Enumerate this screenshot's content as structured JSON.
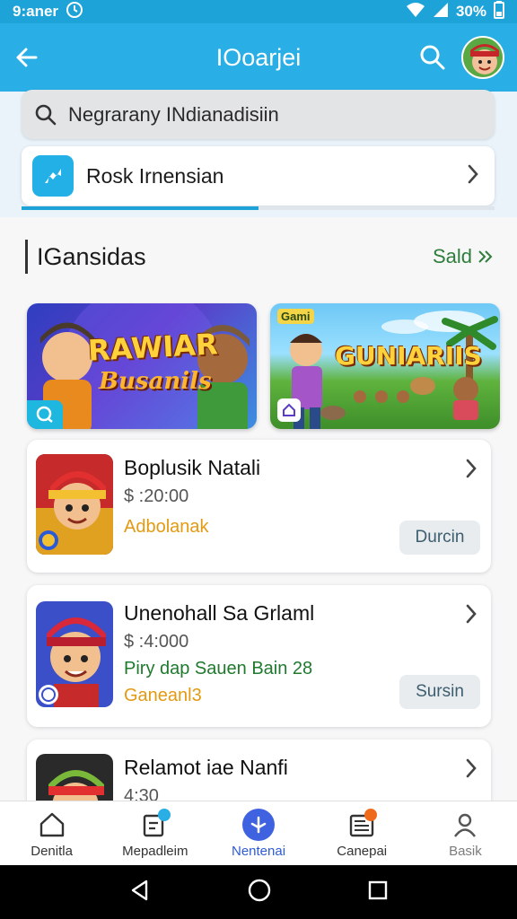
{
  "status_bar": {
    "time": "9:aner",
    "battery": "30%"
  },
  "app_bar": {
    "title": "IOoarjei"
  },
  "search": {
    "placeholder": "Negrarany INdianadisiin"
  },
  "promo": {
    "label": "Rosk Irnensian",
    "progress": 0.5
  },
  "section": {
    "title": "IGansidas",
    "see_all": "Sald"
  },
  "banners": [
    {
      "title": "RAWIAR",
      "subtitle": "Busanils"
    },
    {
      "title": "GUNIARIIS",
      "tag": "Gami"
    }
  ],
  "games": [
    {
      "name": "Boplusik Natali",
      "price": "$ :20:00",
      "meta": "Adbolanak",
      "meta_color": "#e39a13",
      "button": "Durcin"
    },
    {
      "name": "Unenohall Sa Grlaml",
      "price": "$ :4:000",
      "meta_line1": "Piry dap Sauen Bain 28",
      "meta_line1_color": "#1f7a2e",
      "meta": "Ganeanl3",
      "meta_color": "#e39a13",
      "button": "Sursin"
    },
    {
      "name": "Relamot iae Nanfi",
      "price": "4:30"
    }
  ],
  "bottom_nav": [
    {
      "label": "Denitla"
    },
    {
      "label": "Mepadleim"
    },
    {
      "label": "Nentenai"
    },
    {
      "label": "Canepai"
    },
    {
      "label": "Basik"
    }
  ],
  "colors": {
    "accent": "#29aee6",
    "nav_active": "#3f63e0",
    "price_green": "#1f7a2e",
    "meta_orange": "#e39a13"
  }
}
